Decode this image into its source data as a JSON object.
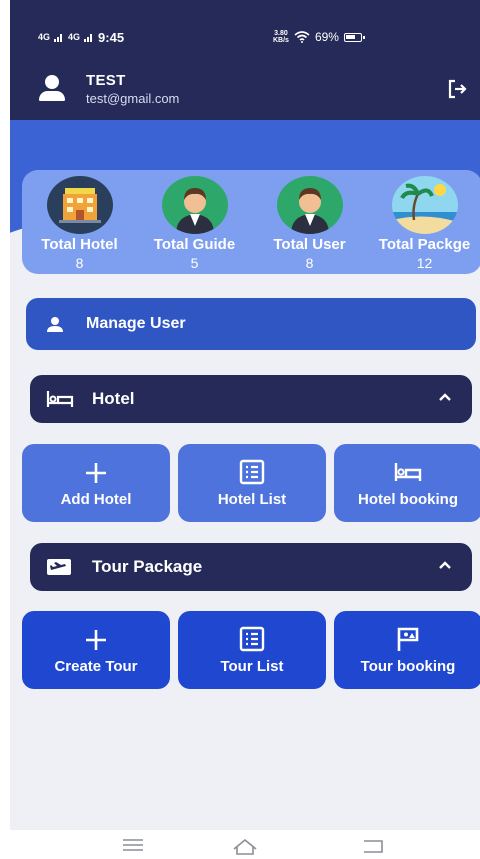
{
  "status_bar": {
    "network_1": "4G",
    "network_2": "4G",
    "time": "9:45",
    "speed_value": "3.80",
    "speed_unit": "KB/s",
    "battery": "69%"
  },
  "header": {
    "user_name": "TEST",
    "user_email": "test@gmail.com",
    "icons": {
      "avatar": "person-icon",
      "logout": "logout-icon"
    }
  },
  "stats": [
    {
      "label": "Total Hotel",
      "value": "8",
      "icon": "hotel-icon"
    },
    {
      "label": "Total Guide",
      "value": "5",
      "icon": "guide-icon"
    },
    {
      "label": "Total User",
      "value": "8",
      "icon": "user-icon"
    },
    {
      "label": "Total Packge",
      "value": "12",
      "icon": "beach-icon"
    }
  ],
  "manage_user": {
    "label": "Manage User",
    "icon": "person-icon"
  },
  "hotel_section": {
    "title": "Hotel",
    "icon": "bed-icon",
    "expanded": true,
    "tiles": [
      {
        "label": "Add Hotel",
        "icon": "plus-icon"
      },
      {
        "label": "Hotel List",
        "icon": "list-icon"
      },
      {
        "label": "Hotel booking",
        "icon": "bed-icon"
      }
    ]
  },
  "tour_section": {
    "title": "Tour Package",
    "icon": "flight-icon",
    "expanded": true,
    "tiles": [
      {
        "label": "Create Tour",
        "icon": "plus-icon"
      },
      {
        "label": "Tour List",
        "icon": "list-icon"
      },
      {
        "label": "Tour booking",
        "icon": "tour-flag-icon"
      }
    ]
  },
  "colors": {
    "header": "#252a58",
    "band": "#3c63d3",
    "stats_card": "#7e9ff0",
    "manage_button": "#2f56c2",
    "hotel_tile": "#4f73dc",
    "tour_tile": "#1f47d0"
  }
}
